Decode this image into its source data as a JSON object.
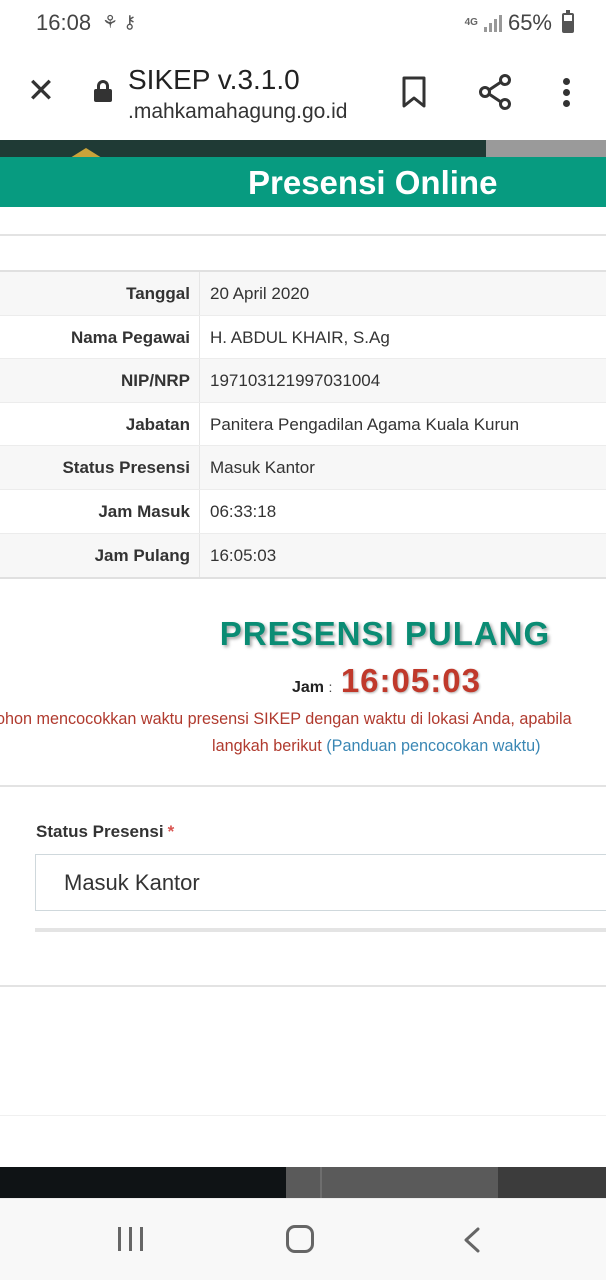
{
  "status_bar": {
    "time": "16:08",
    "left_icons": "⚘ ⚷",
    "network": "4G",
    "battery_percent": "65%",
    "battery_level": 0.65
  },
  "browser": {
    "page_title": "SIKEP v.3.1.0",
    "url": ".mahkamahagung.go.id"
  },
  "header": {
    "title": "Presensi Online"
  },
  "info": [
    {
      "label": "Tanggal",
      "value": "20 April 2020"
    },
    {
      "label": "Nama Pegawai",
      "value": "H. ABDUL KHAIR, S.Ag"
    },
    {
      "label": "NIP/NRP",
      "value": "197103121997031004"
    },
    {
      "label": "Jabatan",
      "value": "Panitera Pengadilan Agama Kuala Kurun"
    },
    {
      "label": "Status Presensi",
      "value": "Masuk Kantor"
    },
    {
      "label": "Jam Masuk",
      "value": "06:33:18"
    },
    {
      "label": "Jam Pulang",
      "value": "16:05:03"
    }
  ],
  "presensi": {
    "title": "PRESENSI PULANG",
    "jam_label": "Jam",
    "jam_colon": ":",
    "jam_value": "16:05:03",
    "warning_line1": "ohon mencocokkan waktu presensi SIKEP dengan waktu di lokasi Anda, apabila",
    "warning_line2": "langkah berikut",
    "guide_link": "(Panduan pencocokan waktu)"
  },
  "form": {
    "status_label": "Status Presensi",
    "required_mark": "*",
    "status_value": "Masuk Kantor"
  }
}
